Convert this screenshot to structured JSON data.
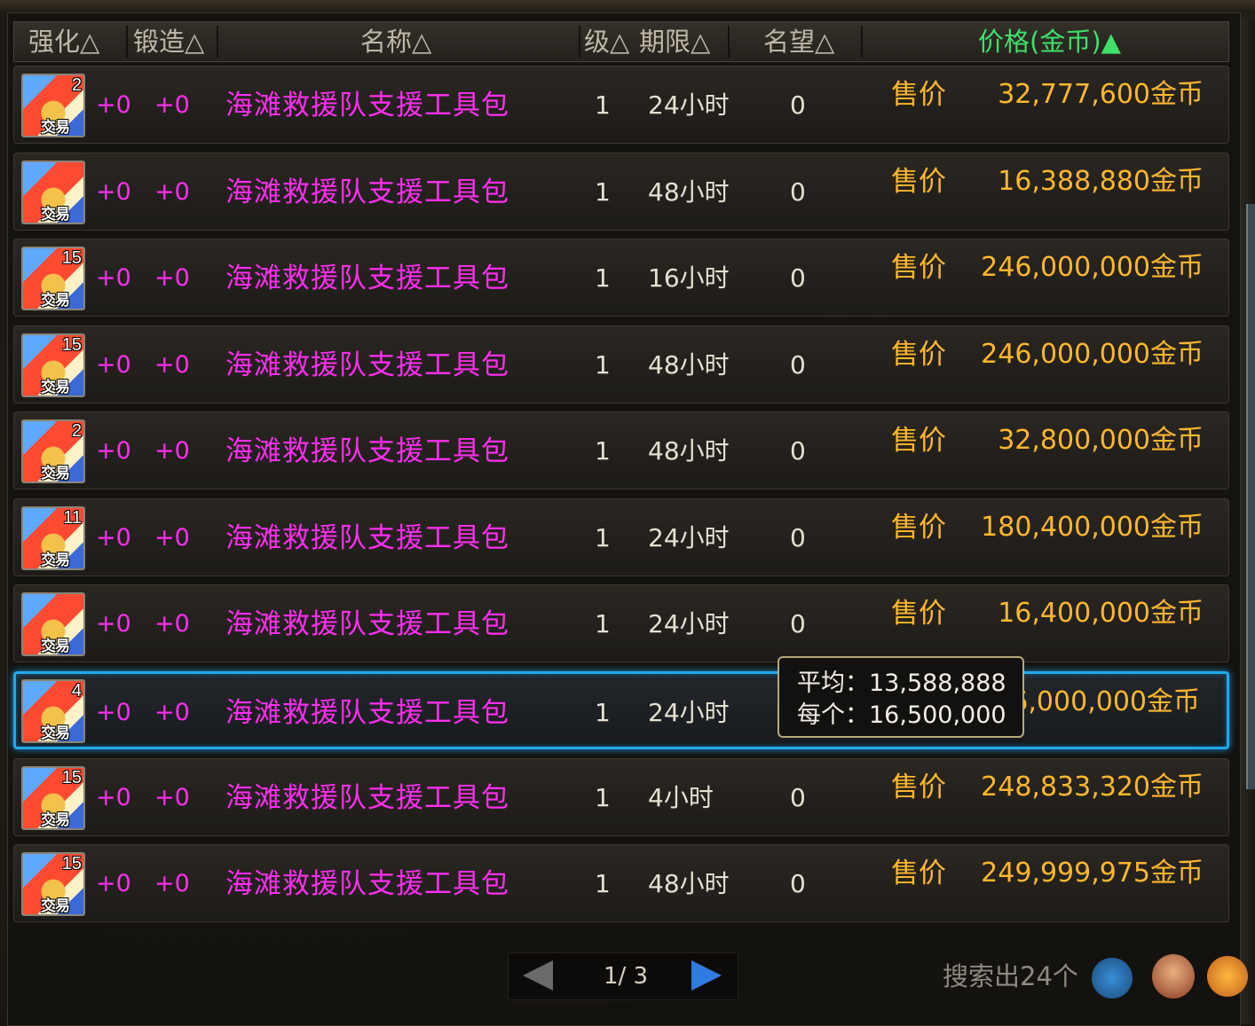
{
  "header": {
    "enhance_label": "强化△",
    "forge_label": "锻造△",
    "name_label": "名称△",
    "level_label": "级△",
    "duration_label": "期限△",
    "reputation_label": "名望△",
    "price_label": "价格(金币)▲"
  },
  "price_label_text": "售价",
  "trade_tag": "交易",
  "rows": [
    {
      "count": "2",
      "enhance": "+0",
      "forge": "+0",
      "name": "海滩救援队支援工具包",
      "level": "1",
      "duration": "24小时",
      "reputation": "0",
      "price": "32,777,600金币"
    },
    {
      "count": "",
      "enhance": "+0",
      "forge": "+0",
      "name": "海滩救援队支援工具包",
      "level": "1",
      "duration": "48小时",
      "reputation": "0",
      "price": "16,388,880金币"
    },
    {
      "count": "15",
      "enhance": "+0",
      "forge": "+0",
      "name": "海滩救援队支援工具包",
      "level": "1",
      "duration": "16小时",
      "reputation": "0",
      "price": "246,000,000金币"
    },
    {
      "count": "15",
      "enhance": "+0",
      "forge": "+0",
      "name": "海滩救援队支援工具包",
      "level": "1",
      "duration": "48小时",
      "reputation": "0",
      "price": "246,000,000金币"
    },
    {
      "count": "2",
      "enhance": "+0",
      "forge": "+0",
      "name": "海滩救援队支援工具包",
      "level": "1",
      "duration": "48小时",
      "reputation": "0",
      "price": "32,800,000金币"
    },
    {
      "count": "11",
      "enhance": "+0",
      "forge": "+0",
      "name": "海滩救援队支援工具包",
      "level": "1",
      "duration": "24小时",
      "reputation": "0",
      "price": "180,400,000金币"
    },
    {
      "count": "",
      "enhance": "+0",
      "forge": "+0",
      "name": "海滩救援队支援工具包",
      "level": "1",
      "duration": "24小时",
      "reputation": "0",
      "price": "16,400,000金币"
    },
    {
      "count": "4",
      "enhance": "+0",
      "forge": "+0",
      "name": "海滩救援队支援工具包",
      "level": "1",
      "duration": "24小时",
      "reputation": "0",
      "price": "66,000,000金币",
      "selected": true
    },
    {
      "count": "15",
      "enhance": "+0",
      "forge": "+0",
      "name": "海滩救援队支援工具包",
      "level": "1",
      "duration": "4小时",
      "reputation": "0",
      "price": "248,833,320金币"
    },
    {
      "count": "15",
      "enhance": "+0",
      "forge": "+0",
      "name": "海滩救援队支援工具包",
      "level": "1",
      "duration": "48小时",
      "reputation": "0",
      "price": "249,999,975金币"
    }
  ],
  "tooltip": {
    "average": "平均：13,588,888",
    "each": "每个：16,500,000"
  },
  "pager": {
    "text": "1/ 3"
  },
  "result_count": "搜索出24个",
  "colors": {
    "name": "#ff2ef0",
    "price": "#ffb72c",
    "active_sort": "#3fe06a",
    "selected_border": "#22a8e8"
  }
}
